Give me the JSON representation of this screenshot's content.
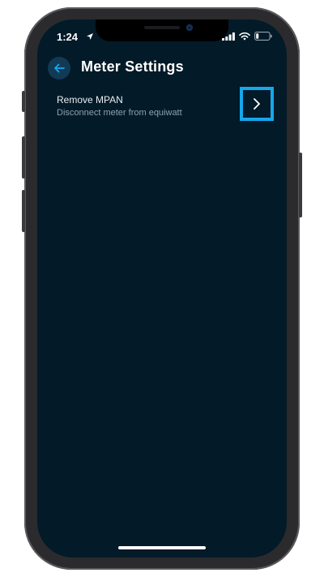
{
  "status_bar": {
    "time": "1:24",
    "location_icon": "location-arrow-icon",
    "signal_icon": "cellular-signal-icon",
    "wifi_icon": "wifi-icon",
    "battery_icon": "battery-icon"
  },
  "header": {
    "title": "Meter Settings",
    "back_icon": "arrow-left-icon"
  },
  "settings": [
    {
      "title": "Remove MPAN",
      "subtitle": "Disconnect meter from equiwatt",
      "action_icon": "chevron-right-icon"
    }
  ],
  "colors": {
    "background": "#031a28",
    "accent": "#16a7ec",
    "back_button_bg": "#133a55",
    "text_primary": "#ffffff",
    "text_secondary": "#8ea2b0"
  }
}
